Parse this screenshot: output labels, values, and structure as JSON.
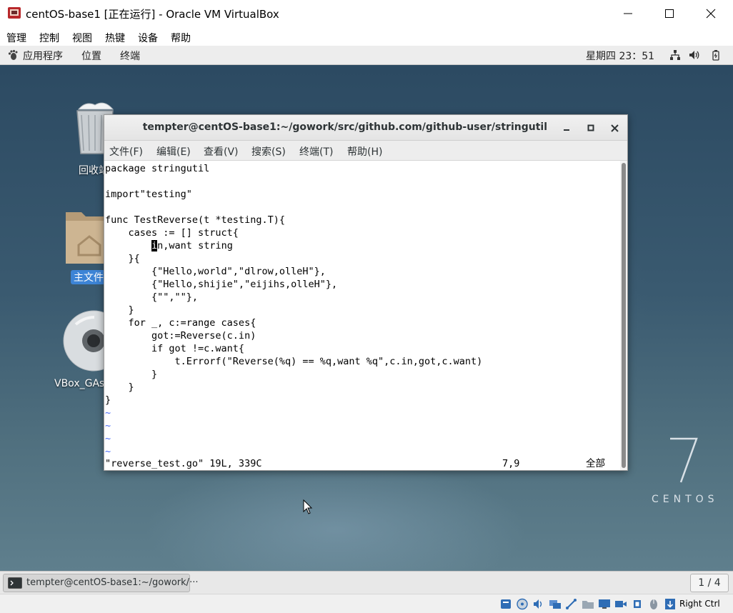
{
  "vbox": {
    "title": "centOS-base1 [正在运行] - Oracle VM VirtualBox",
    "menu": [
      "管理",
      "控制",
      "视图",
      "热键",
      "设备",
      "帮助"
    ],
    "host_key": "Right Ctrl"
  },
  "gnome_panel": {
    "applications": "应用程序",
    "places": "位置",
    "terminal": "终端",
    "clock": "星期四 23：51"
  },
  "desktop": {
    "icons": [
      {
        "label": "回收站",
        "icon": "trash-icon"
      },
      {
        "label": "主文件夹",
        "icon": "home-folder-icon"
      },
      {
        "label": "VBox_GAs",
        "icon": "cd-rom-icon"
      }
    ],
    "brand_number": "7",
    "brand_word": "CENTOS"
  },
  "terminal": {
    "title": "tempter@centOS-base1:~/gowork/src/github.com/github-user/stringutil",
    "menu": [
      "文件(F)",
      "编辑(E)",
      "查看(V)",
      "搜索(S)",
      "终端(T)",
      "帮助(H)"
    ],
    "lines": [
      "package stringutil",
      "",
      "import\"testing\"",
      "",
      "func TestReverse(t *testing.T){",
      "    cases := [] struct{",
      "        in,want string",
      "    }{",
      "        {\"Hello,world\",\"dlrow,olleH\"},",
      "        {\"Hello,shijie\",\"eijihs,olleH\"},",
      "        {\"\",\"\"},",
      "    }",
      "    for _, c:=range cases{",
      "        got:=Reverse(c.in)",
      "        if got !=c.want{",
      "            t.Errorf(\"Reverse(%q) == %q,want %q\",c.in,got,c.want)",
      "        }",
      "    }",
      "}",
      "~",
      "~",
      "~",
      "~"
    ],
    "cursor": {
      "line": 6,
      "col": 8
    },
    "status_file": "\"reverse_test.go\" 19L, 339C",
    "status_position": "7,9",
    "status_percent": "全部"
  },
  "taskbar": {
    "window_label": "tempter@centOS-base1:~/gowork/···",
    "workspace": "1 / 4"
  },
  "colors": {
    "tilde": "#4a6cf7",
    "selection": "#3d84d6"
  }
}
